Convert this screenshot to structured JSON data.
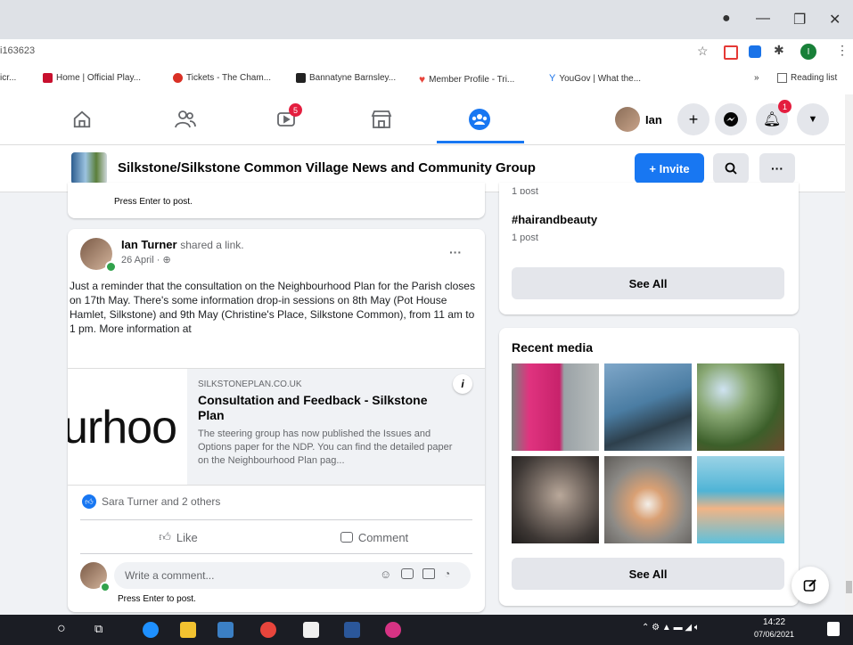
{
  "browser": {
    "url_fragment": "i163623",
    "bookmarks": [
      {
        "label": "icr...",
        "color": "#1877f2"
      },
      {
        "label": "Home | Official Play...",
        "color": "#c8102e"
      },
      {
        "label": "Tickets - The Cham...",
        "color": "#d93025"
      },
      {
        "label": "Bannatyne Barnsley...",
        "color": "#222222"
      },
      {
        "label": "Member Profile - Tri...",
        "color": "#e8453c"
      },
      {
        "label": "YouGov | What the...",
        "color": "#1a73e8"
      }
    ],
    "more_label": "»",
    "reading_list_label": "Reading list",
    "profile_initial": "I"
  },
  "fbnav": {
    "user_name": "Ian",
    "video_badge": "5",
    "notif_badge": "1"
  },
  "group": {
    "title": "Silkstone/Silkstone Common Village News and Community Group",
    "invite_label": "+ Invite"
  },
  "feed": {
    "top_press_enter": "Press Enter to post.",
    "post": {
      "author": "Ian Turner",
      "action": "shared a link.",
      "date": "26 April · ⊕",
      "text": "Just a reminder that the consultation on the Neighbourhood Plan for the Parish closes on 17th May.  There's some information drop-in sessions on 8th May (Pot House Hamlet, Silkstone) and 9th May (Christine's Place, Silkstone Common), from 11 am to 1 pm.  More information at",
      "link_thumb_text": "urhoo",
      "link_domain": "SILKSTONEPLAN.CO.UK",
      "link_title": "Consultation and Feedback - Silkstone Plan",
      "link_desc": "The steering group has now published the Issues and Options paper for the NDP.  You can find the detailed paper on the Neighbourhood Plan pag...",
      "reactions": "Sara Turner and 2 others",
      "like_label": "Like",
      "comment_label": "Comment",
      "comment_placeholder": "Write a comment...",
      "press_enter": "Press Enter to post."
    }
  },
  "sidebar": {
    "top_cut": "1 post",
    "hashtag": "#hairandbeauty",
    "hashtag_count": "1 post",
    "see_all_1": "See All",
    "recent_media_title": "Recent media",
    "see_all_2": "See All"
  },
  "taskbar": {
    "time": "14:22",
    "date": "07/06/2021"
  },
  "colors": {
    "fb_blue": "#1877f2",
    "taskbar": "#1b1d24"
  }
}
